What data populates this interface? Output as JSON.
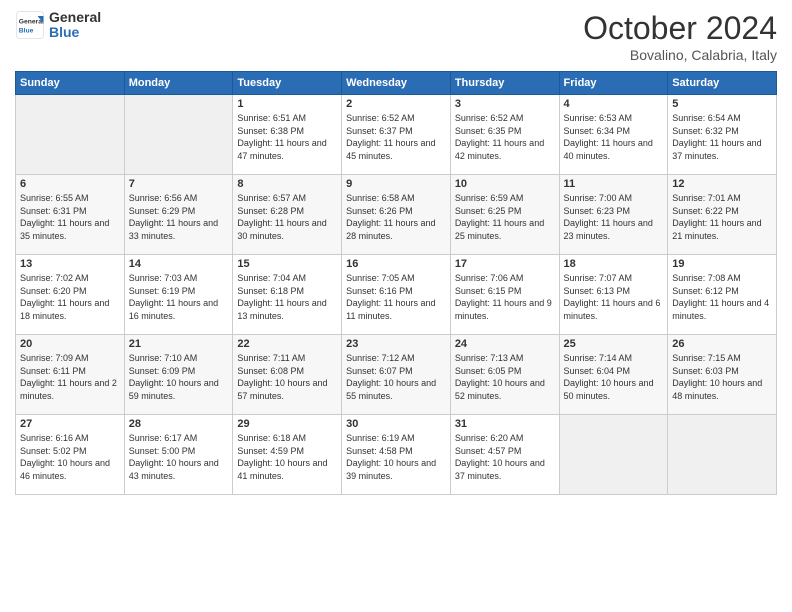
{
  "logo": {
    "general": "General",
    "blue": "Blue"
  },
  "title": "October 2024",
  "subtitle": "Bovalino, Calabria, Italy",
  "days_of_week": [
    "Sunday",
    "Monday",
    "Tuesday",
    "Wednesday",
    "Thursday",
    "Friday",
    "Saturday"
  ],
  "weeks": [
    [
      {
        "day": "",
        "info": ""
      },
      {
        "day": "",
        "info": ""
      },
      {
        "day": "1",
        "info": "Sunrise: 6:51 AM\nSunset: 6:38 PM\nDaylight: 11 hours and 47 minutes."
      },
      {
        "day": "2",
        "info": "Sunrise: 6:52 AM\nSunset: 6:37 PM\nDaylight: 11 hours and 45 minutes."
      },
      {
        "day": "3",
        "info": "Sunrise: 6:52 AM\nSunset: 6:35 PM\nDaylight: 11 hours and 42 minutes."
      },
      {
        "day": "4",
        "info": "Sunrise: 6:53 AM\nSunset: 6:34 PM\nDaylight: 11 hours and 40 minutes."
      },
      {
        "day": "5",
        "info": "Sunrise: 6:54 AM\nSunset: 6:32 PM\nDaylight: 11 hours and 37 minutes."
      }
    ],
    [
      {
        "day": "6",
        "info": "Sunrise: 6:55 AM\nSunset: 6:31 PM\nDaylight: 11 hours and 35 minutes."
      },
      {
        "day": "7",
        "info": "Sunrise: 6:56 AM\nSunset: 6:29 PM\nDaylight: 11 hours and 33 minutes."
      },
      {
        "day": "8",
        "info": "Sunrise: 6:57 AM\nSunset: 6:28 PM\nDaylight: 11 hours and 30 minutes."
      },
      {
        "day": "9",
        "info": "Sunrise: 6:58 AM\nSunset: 6:26 PM\nDaylight: 11 hours and 28 minutes."
      },
      {
        "day": "10",
        "info": "Sunrise: 6:59 AM\nSunset: 6:25 PM\nDaylight: 11 hours and 25 minutes."
      },
      {
        "day": "11",
        "info": "Sunrise: 7:00 AM\nSunset: 6:23 PM\nDaylight: 11 hours and 23 minutes."
      },
      {
        "day": "12",
        "info": "Sunrise: 7:01 AM\nSunset: 6:22 PM\nDaylight: 11 hours and 21 minutes."
      }
    ],
    [
      {
        "day": "13",
        "info": "Sunrise: 7:02 AM\nSunset: 6:20 PM\nDaylight: 11 hours and 18 minutes."
      },
      {
        "day": "14",
        "info": "Sunrise: 7:03 AM\nSunset: 6:19 PM\nDaylight: 11 hours and 16 minutes."
      },
      {
        "day": "15",
        "info": "Sunrise: 7:04 AM\nSunset: 6:18 PM\nDaylight: 11 hours and 13 minutes."
      },
      {
        "day": "16",
        "info": "Sunrise: 7:05 AM\nSunset: 6:16 PM\nDaylight: 11 hours and 11 minutes."
      },
      {
        "day": "17",
        "info": "Sunrise: 7:06 AM\nSunset: 6:15 PM\nDaylight: 11 hours and 9 minutes."
      },
      {
        "day": "18",
        "info": "Sunrise: 7:07 AM\nSunset: 6:13 PM\nDaylight: 11 hours and 6 minutes."
      },
      {
        "day": "19",
        "info": "Sunrise: 7:08 AM\nSunset: 6:12 PM\nDaylight: 11 hours and 4 minutes."
      }
    ],
    [
      {
        "day": "20",
        "info": "Sunrise: 7:09 AM\nSunset: 6:11 PM\nDaylight: 11 hours and 2 minutes."
      },
      {
        "day": "21",
        "info": "Sunrise: 7:10 AM\nSunset: 6:09 PM\nDaylight: 10 hours and 59 minutes."
      },
      {
        "day": "22",
        "info": "Sunrise: 7:11 AM\nSunset: 6:08 PM\nDaylight: 10 hours and 57 minutes."
      },
      {
        "day": "23",
        "info": "Sunrise: 7:12 AM\nSunset: 6:07 PM\nDaylight: 10 hours and 55 minutes."
      },
      {
        "day": "24",
        "info": "Sunrise: 7:13 AM\nSunset: 6:05 PM\nDaylight: 10 hours and 52 minutes."
      },
      {
        "day": "25",
        "info": "Sunrise: 7:14 AM\nSunset: 6:04 PM\nDaylight: 10 hours and 50 minutes."
      },
      {
        "day": "26",
        "info": "Sunrise: 7:15 AM\nSunset: 6:03 PM\nDaylight: 10 hours and 48 minutes."
      }
    ],
    [
      {
        "day": "27",
        "info": "Sunrise: 6:16 AM\nSunset: 5:02 PM\nDaylight: 10 hours and 46 minutes."
      },
      {
        "day": "28",
        "info": "Sunrise: 6:17 AM\nSunset: 5:00 PM\nDaylight: 10 hours and 43 minutes."
      },
      {
        "day": "29",
        "info": "Sunrise: 6:18 AM\nSunset: 4:59 PM\nDaylight: 10 hours and 41 minutes."
      },
      {
        "day": "30",
        "info": "Sunrise: 6:19 AM\nSunset: 4:58 PM\nDaylight: 10 hours and 39 minutes."
      },
      {
        "day": "31",
        "info": "Sunrise: 6:20 AM\nSunset: 4:57 PM\nDaylight: 10 hours and 37 minutes."
      },
      {
        "day": "",
        "info": ""
      },
      {
        "day": "",
        "info": ""
      }
    ]
  ]
}
